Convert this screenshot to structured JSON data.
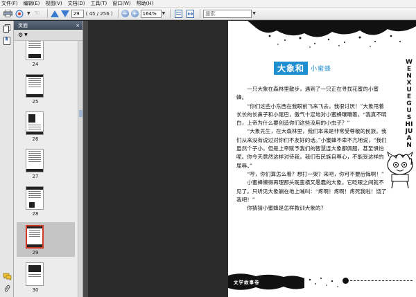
{
  "menu": [
    "文件(F)",
    "编辑(E)",
    "视图(V)",
    "文档(D)",
    "工具(T)",
    "窗口(W)",
    "帮助(H)"
  ],
  "toolbar": {
    "page_current": "29",
    "page_count": "( 45 / 256 )",
    "zoom": "164%",
    "search_placeholder": "搜索"
  },
  "panel": {
    "title": "页面",
    "close": "×"
  },
  "thumbnails": [
    {
      "label": "24"
    },
    {
      "label": "25"
    },
    {
      "label": "26"
    },
    {
      "label": "27"
    },
    {
      "label": "28"
    },
    {
      "label": "29",
      "selected": true
    },
    {
      "label": "30"
    }
  ],
  "page": {
    "title_main": "大象和",
    "title_sub": "小蜜蜂",
    "vertical_text": "WENXUEGUSHIJUAN",
    "footer_label": "文学故事卷",
    "paragraphs": [
      "一只大象在森林里散步，遇到了一只正在寻找花蜜的小蜜蜂。",
      "“你们这些小东西在我眼前飞来飞去，我很讨厌！”大象甩着长长的长鼻子和小尾巴，傲气十足地对小蜜蜂嚷嚷着，“我真不明白，上帝为什么要创造你们这些没用的小虫子？”",
      "“大象先生，在大森林里，我们本来是非常受尊敬的民族。我们从来没有说过对你们不友好的话。”小蜜蜂不卑不亢地说，“我们虽然个子小，但是上帝赋予我们的智慧连大象都佩服，甚至惧怕呢。你今天竟然这样对待我，我们有民族自尊心，不能受这样的屈辱。”",
      "“哼，你们算怎么着？想打一架？来吧，你可不要后悔啊！”",
      "小蜜蜂懒得再理那头既蛮横又愚蠢的大象，它眨眼之间就不见了。只听见大象躺在地上喊叫：“疼啊！疼啊！疼死我啦！饶了我吧！”",
      "你猜猜小蜜蜂是怎样教训大象的？"
    ]
  }
}
